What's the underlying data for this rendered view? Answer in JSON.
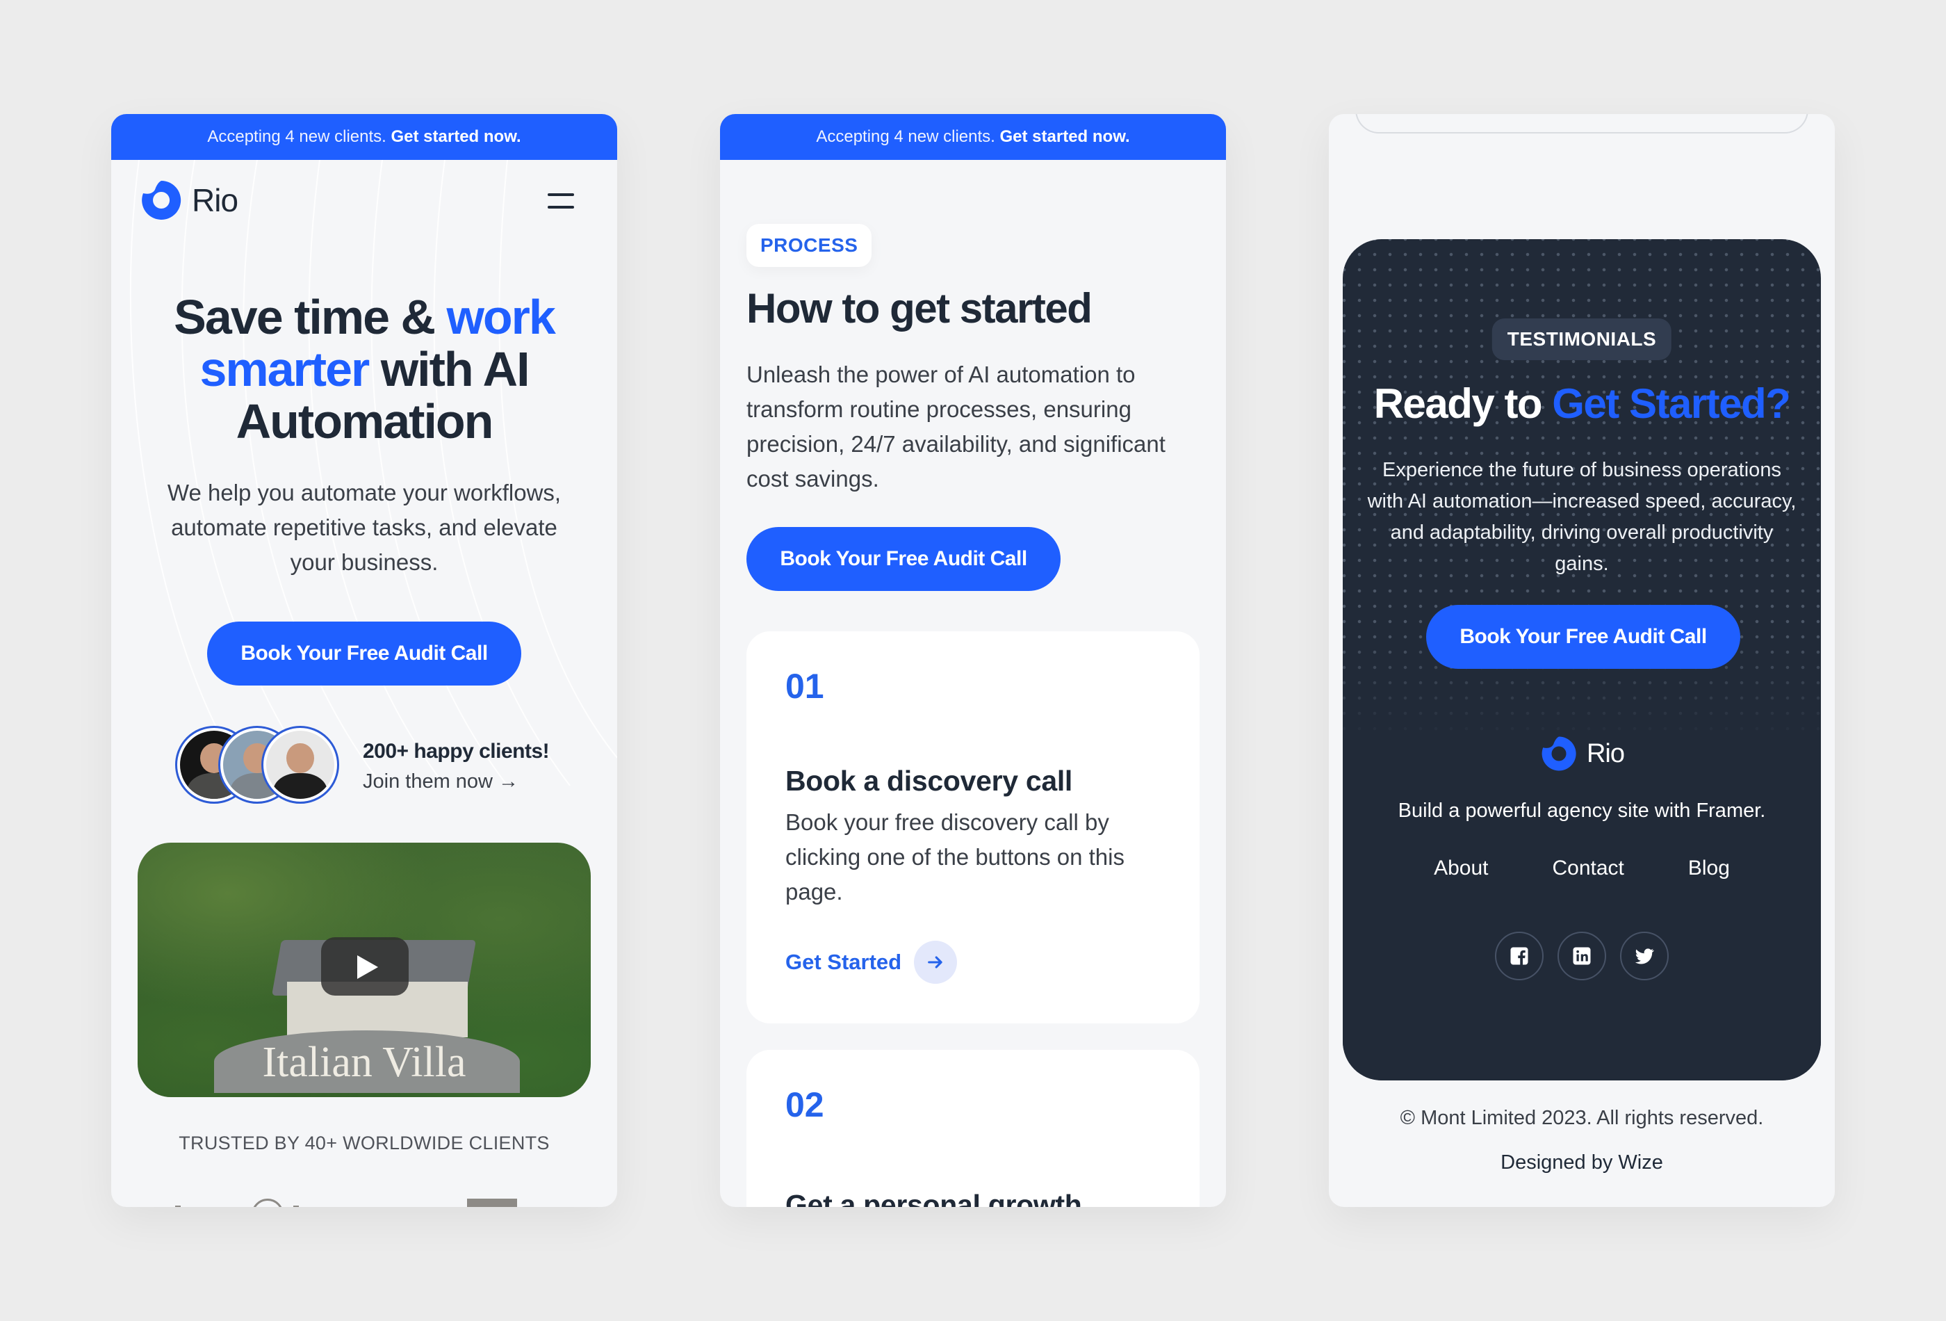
{
  "brand": {
    "name": "Rio",
    "primary_color": "#1f5fff",
    "dark_color": "#212a38"
  },
  "banner": {
    "text": "Accepting 4 new clients.",
    "link": "Get started now."
  },
  "panel1": {
    "hero": {
      "title_part1": "Save time & ",
      "title_accent": "work smarter",
      "title_part2": " with AI Automation",
      "subtitle": "We help you automate your workflows, automate repetitive tasks, and elevate your business.",
      "cta": "Book Your Free Audit Call"
    },
    "social_proof": {
      "title": "200+ happy clients!",
      "link": "Join them now →",
      "avatars": [
        "client-avatar-1",
        "client-avatar-2",
        "client-avatar-3"
      ]
    },
    "video": {
      "title": "Italian Villa",
      "icon": "play-icon"
    },
    "trusted": "TRUSTED BY 40+ WORLDWIDE CLIENTS"
  },
  "panel2": {
    "eyebrow": "PROCESS",
    "title": "How to get started",
    "subtitle": "Unleash the power of AI automation to transform routine processes, ensuring precision, 24/7 availability, and significant cost savings.",
    "cta": "Book Your Free Audit Call",
    "steps": [
      {
        "number": "01",
        "title": "Book a discovery call",
        "description": "Book your free discovery call by clicking one of the buttons on this page.",
        "link": "Get Started"
      },
      {
        "number": "02",
        "title": "Get a personal growth",
        "description": "",
        "link": ""
      }
    ]
  },
  "panel3": {
    "eyebrow": "TESTIMONIALS",
    "title_part1": "Ready to ",
    "title_accent": "Get Started?",
    "subtitle": "Experience the future of business operations with AI automation—increased speed, accuracy, and adaptability, driving overall productivity gains.",
    "cta": "Book Your Free Audit Call",
    "footer": {
      "tagline": "Build a powerful agency site with Framer.",
      "nav": [
        "About",
        "Contact",
        "Blog"
      ],
      "socials": [
        "facebook-icon",
        "linkedin-icon",
        "twitter-icon"
      ],
      "copyright": "© Mont Limited 2023. All rights reserved.",
      "designed_by": "Designed by Wize"
    }
  }
}
